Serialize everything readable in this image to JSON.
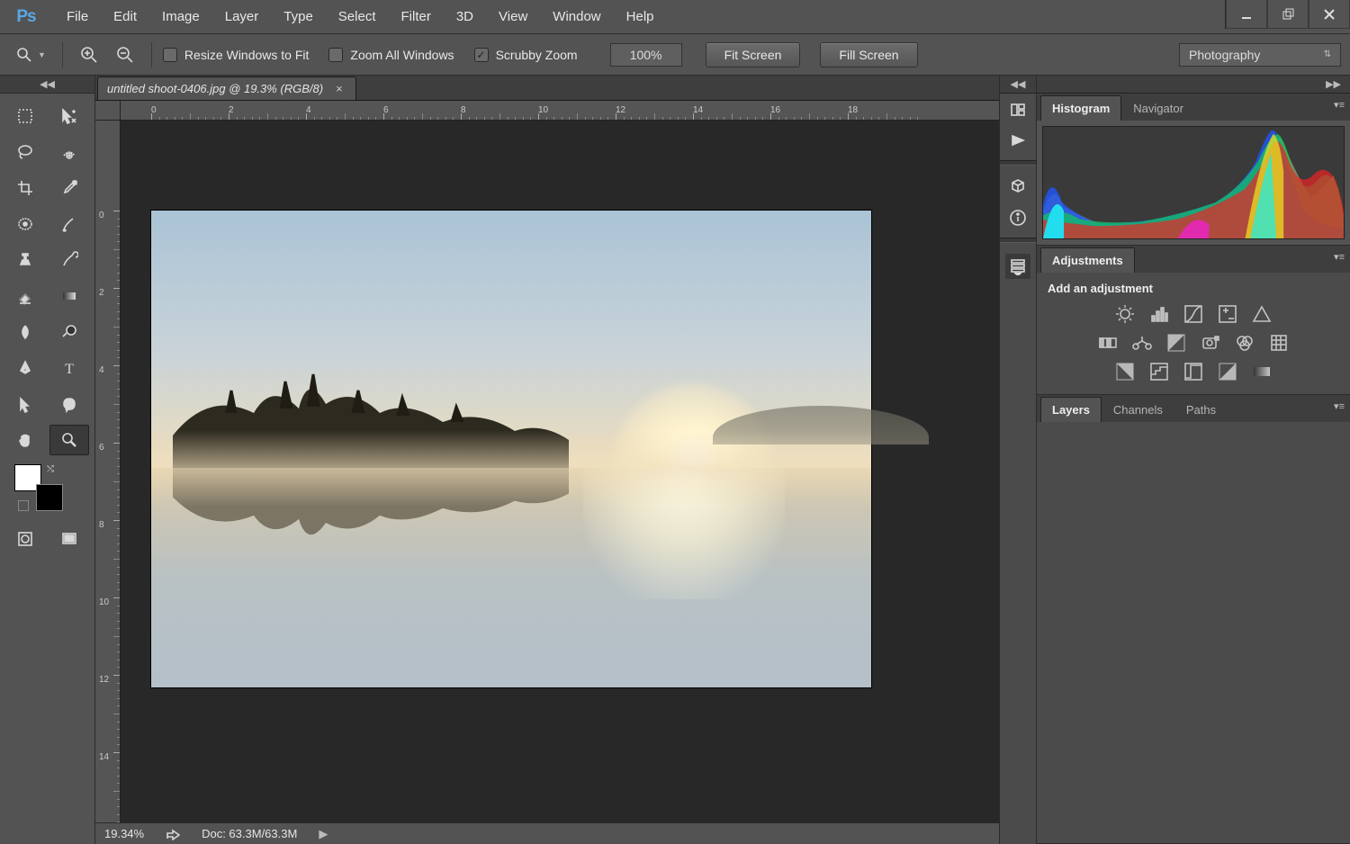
{
  "menubar": {
    "logo": "Ps",
    "items": [
      "File",
      "Edit",
      "Image",
      "Layer",
      "Type",
      "Select",
      "Filter",
      "3D",
      "View",
      "Window",
      "Help"
    ]
  },
  "optionsbar": {
    "resize_windows": "Resize Windows to Fit",
    "zoom_all": "Zoom All Windows",
    "scrubby_zoom": "Scrubby Zoom",
    "scrubby_checked": true,
    "zoom_value": "100%",
    "fit_screen": "Fit Screen",
    "fill_screen": "Fill Screen",
    "workspace": "Photography"
  },
  "document": {
    "tab_title": "untitled shoot-0406.jpg @ 19.3% (RGB/8)",
    "ruler_marks_h": [
      "0",
      "2",
      "4",
      "6",
      "8",
      "10",
      "12",
      "14",
      "16",
      "18"
    ],
    "ruler_marks_v": [
      "0",
      "2",
      "4",
      "6",
      "8",
      "10",
      "12",
      "14"
    ]
  },
  "statusbar": {
    "zoom": "19.34%",
    "doc_info": "Doc: 63.3M/63.3M"
  },
  "panels": {
    "histogram_tab": "Histogram",
    "navigator_tab": "Navigator",
    "adjustments_tab": "Adjustments",
    "adjustments_title": "Add an adjustment",
    "layers_tab": "Layers",
    "channels_tab": "Channels",
    "paths_tab": "Paths"
  }
}
